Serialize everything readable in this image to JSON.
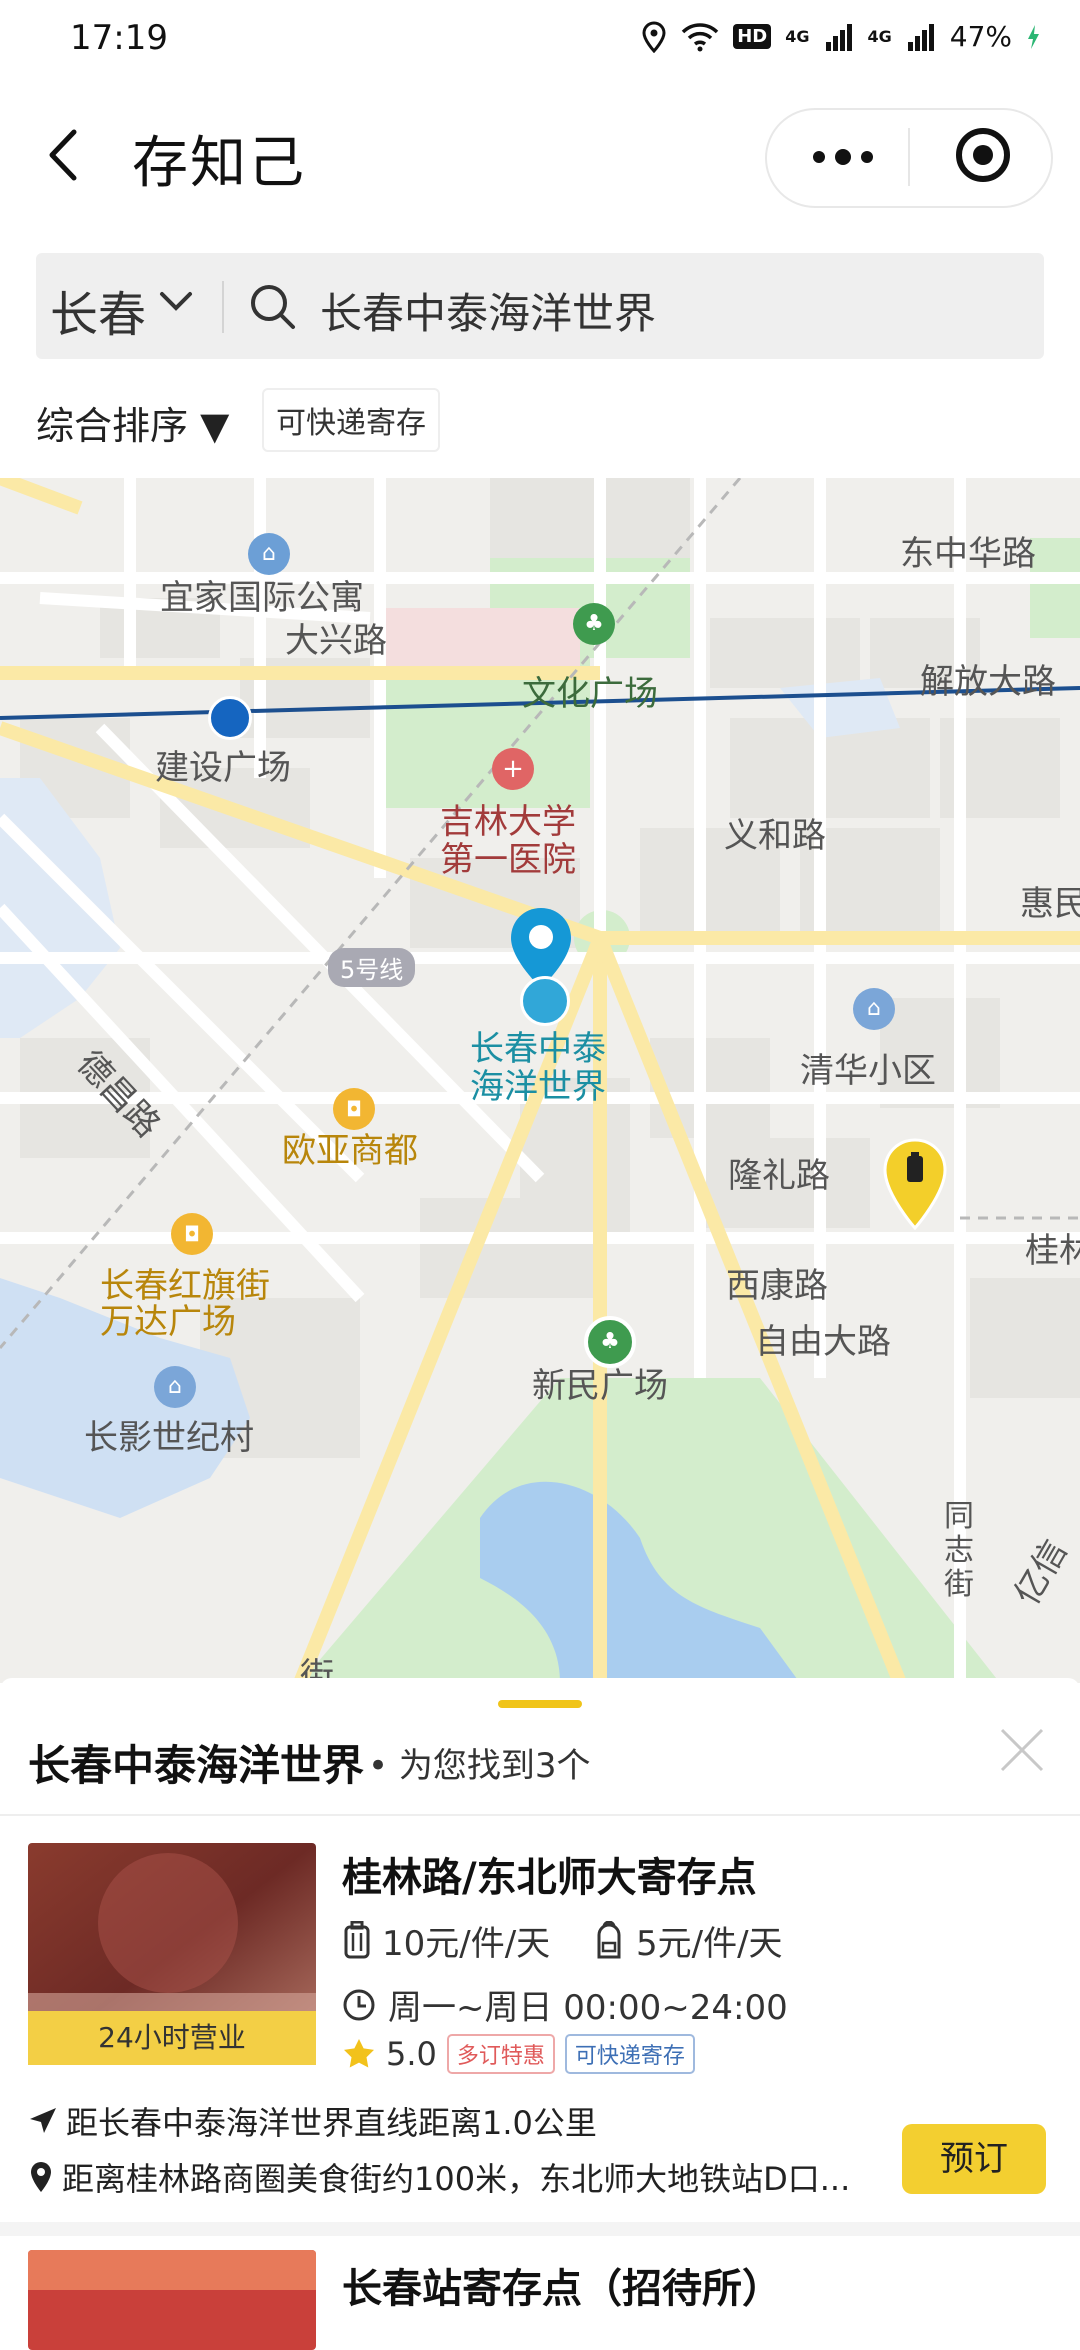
{
  "status_bar": {
    "time": "17:19",
    "battery": "47%",
    "network1": "4G",
    "network2": "4G",
    "hd": "HD"
  },
  "header": {
    "title": "存知己"
  },
  "search": {
    "city": "长春",
    "query": "长春中泰海洋世界"
  },
  "filters": {
    "sort": "综合排序 ▼",
    "chip": "可快递寄存"
  },
  "map": {
    "labels": {
      "hostel": "宜家国际公寓",
      "daxing": "大兴路",
      "wenhua": "文化广场",
      "dongzhonghua": "东中华路",
      "jiefang": "解放大路",
      "jianshe": "建设广场",
      "hospital": "吉林大学\n第一医院",
      "yihe": "义和路",
      "hui": "惠民",
      "line5": "5号线",
      "target": "长春中泰\n海洋世界",
      "qinghua": "清华小区",
      "dechang": "德昌路",
      "ouya": "欧亚商都",
      "longli": "隆礼路",
      "guilin": "桂林",
      "wanda": "长春红旗街\n万达广场",
      "xikang": "西康路",
      "ziyou": "自由大路",
      "xinmin": "新民广场",
      "changying": "长影世纪村",
      "tongzhi": "同\n志\n街",
      "jie": "街",
      "xin": "亿信"
    }
  },
  "sheet": {
    "title": "长春中泰海洋世界",
    "count_text": "• 为您找到3个",
    "stores": [
      {
        "name": "桂林路/东北师大寄存点",
        "badge": "24小时营业",
        "price_large": "10元/件/天",
        "price_small": "5元/件/天",
        "hours": "周一~周日 00:00~24:00",
        "rating": "5.0",
        "tag1": "多订特惠",
        "tag2": "可快递寄存",
        "distance": "距长春中泰海洋世界直线距离1.0公里",
        "address": "距离桂林路商圈美食街约100米，东北师大地铁站D口...",
        "book": "预订"
      },
      {
        "name": "长春站寄存点（招待所）"
      }
    ]
  }
}
